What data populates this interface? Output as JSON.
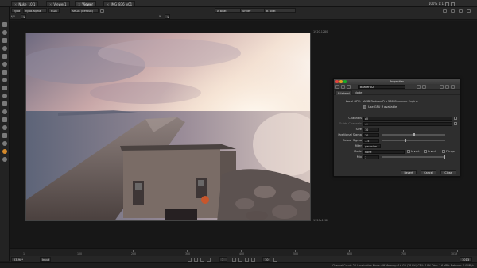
{
  "tabs": [
    {
      "label": "Nuke_10.1",
      "active": false
    },
    {
      "label": "Viewer1",
      "active": false
    },
    {
      "label": "Viewer",
      "active": true
    },
    {
      "label": "IMG_836_v01",
      "active": false
    }
  ],
  "tab_right": {
    "zoom_label": "100% 1:1"
  },
  "viewer_toolbar": {
    "layer": "rgba",
    "channel": "rgba.alpha",
    "colorspace": "RGB",
    "lut": "sRGB (default)",
    "input_a": "A Bilat",
    "operation": "under",
    "input_b": "B Bilat",
    "frame": "1",
    "gain": "1",
    "gamma_label": "Y",
    "gamma": "1"
  },
  "viewer": {
    "coord_top_right": "1920,1280",
    "coord_bottom_right": "1920x1280"
  },
  "properties": {
    "window_title": "Properties",
    "node_name": "Bilateral2",
    "tabs": [
      "Bilateral",
      "Node"
    ],
    "local_gpu_label": "Local GPU:",
    "local_gpu_value": "AMD Radeon Pro 560 Compute Engine",
    "use_gpu_label": "Use GPU if available",
    "fields": [
      {
        "label": "Channels",
        "value": "all",
        "dim": false
      },
      {
        "label": "Guide Channels",
        "value": "all",
        "dim": true
      },
      {
        "label": "Size",
        "value": "10",
        "dim": false
      },
      {
        "label": "Positional Sigma",
        "value": "10",
        "dim": false
      },
      {
        "label": "Colour Sigma",
        "value": "7.5",
        "dim": false
      },
      {
        "label": "filter",
        "value": "gaussian",
        "dim": false
      },
      {
        "label": "Mode",
        "value": "none",
        "dim": false
      },
      {
        "label": "Mix",
        "value": "1",
        "dim": false
      }
    ],
    "mode_extra": [
      "Invert",
      "Invert",
      "Fringe"
    ],
    "buttons": {
      "revert": "Revert",
      "cancel": "Cancel",
      "close": "Close"
    }
  },
  "timeline": {
    "start": "1",
    "ticks": [
      "100",
      "200",
      "300",
      "400",
      "500",
      "600",
      "700",
      "800",
      "900",
      "1000"
    ],
    "end_frame": "1013",
    "fps_label": "23.98*",
    "input_label": "Input",
    "frame_field": "1",
    "step": "10",
    "global_end": "1013"
  },
  "status": "Channel Count: 24  Localization Mode: Off  Memory: 4.6 GB (28.8%)  CPU: 7.8%  Disk: 1.6 MB/s  Network: 0.0 MB/s",
  "colors": {
    "accent": "#d5892a",
    "panel_bg": "#2e2e2e",
    "app_bg": "#1a1a1a"
  }
}
